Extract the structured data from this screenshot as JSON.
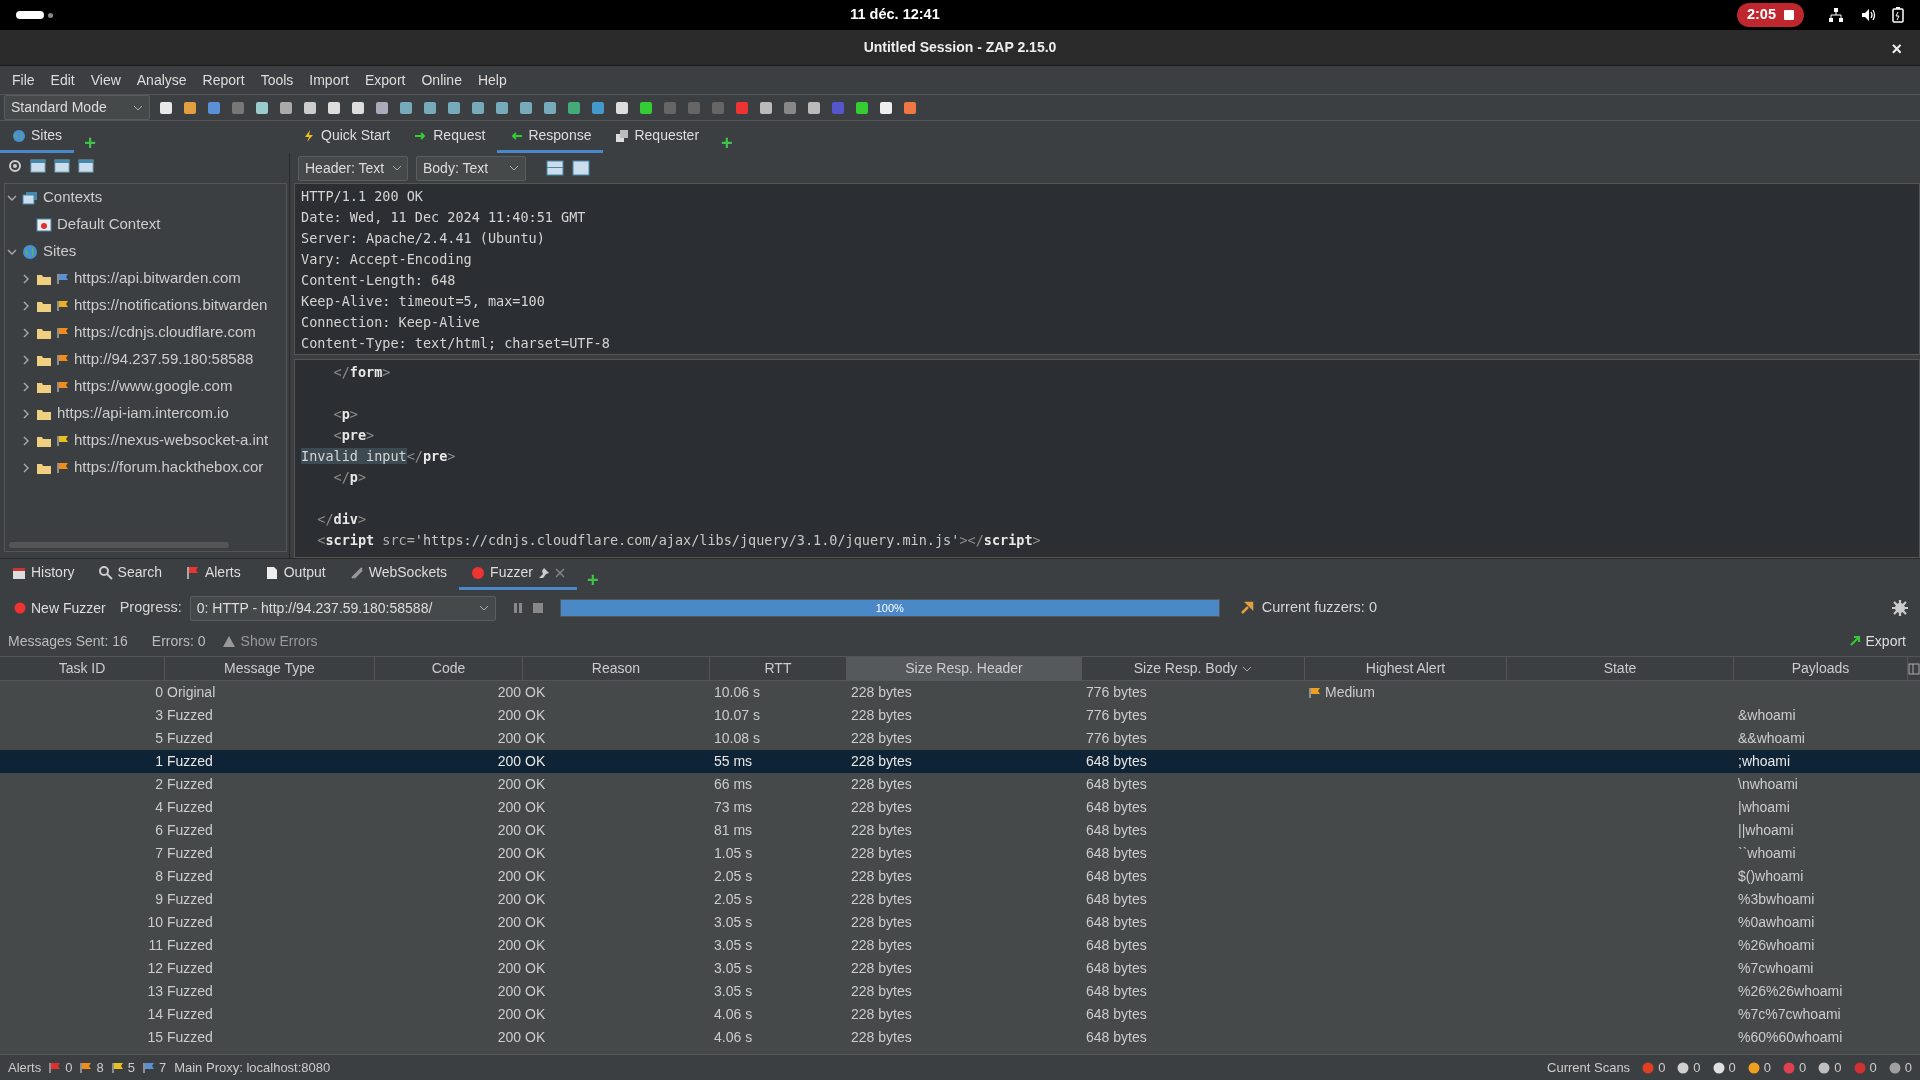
{
  "topbar": {
    "clock": "11 déc. 12:41",
    "recording": "2:05"
  },
  "window": {
    "title": "Untitled Session - ZAP 2.15.0",
    "close": "×"
  },
  "menu": [
    "File",
    "Edit",
    "View",
    "Analyse",
    "Report",
    "Tools",
    "Import",
    "Export",
    "Online",
    "Help"
  ],
  "toolbar": {
    "mode": "Standard Mode"
  },
  "left_tabs": [
    {
      "label": "Sites",
      "selected": true
    }
  ],
  "left_add_tab": "+",
  "sites_tree": [
    {
      "label": "Contexts",
      "expanded": true,
      "kind": "contexts",
      "children": [
        {
          "label": "Default Context",
          "kind": "context"
        }
      ]
    },
    {
      "label": "Sites",
      "expanded": true,
      "kind": "sites",
      "children": [
        {
          "label": "https://api.bitwarden.com",
          "expanded": false,
          "kind": "site",
          "color": "#5b8fd6"
        },
        {
          "label": "https://notifications.bitwarden",
          "expanded": false,
          "kind": "site",
          "color": "#e8b020"
        },
        {
          "label": "https://cdnjs.cloudflare.com",
          "expanded": false,
          "kind": "site",
          "color": "#f08c1c"
        },
        {
          "label": "http://94.237.59.180:58588",
          "expanded": false,
          "kind": "site",
          "color": "#f08c1c"
        },
        {
          "label": "https://www.google.com",
          "expanded": false,
          "kind": "site",
          "color": "#f08c1c"
        },
        {
          "label": "https://api-iam.intercom.io",
          "expanded": false,
          "kind": "site"
        },
        {
          "label": "https://nexus-websocket-a.int",
          "expanded": false,
          "kind": "site",
          "color": "#e8c020"
        },
        {
          "label": "https://forum.hackthebox.cor",
          "expanded": false,
          "kind": "site",
          "color": "#f08c1c"
        }
      ]
    }
  ],
  "work_tabs": [
    {
      "label": "Quick Start",
      "selected": false,
      "kind": "bolt"
    },
    {
      "label": "Request",
      "selected": false,
      "kind": "right"
    },
    {
      "label": "Response",
      "selected": true,
      "kind": "left"
    },
    {
      "label": "Requester",
      "selected": false,
      "kind": "pages"
    }
  ],
  "work_add_tab": "+",
  "view_selects": [
    "Header: Text",
    "Body: Text"
  ],
  "response_header": [
    "HTTP/1.1 200 OK",
    "Date: Wed, 11 Dec 2024 11:40:51 GMT",
    "Server: Apache/2.4.41 (Ubuntu)",
    "Vary: Accept-Encoding",
    "Content-Length: 648",
    "Keep-Alive: timeout=5, max=100",
    "Connection: Keep-Alive",
    "Content-Type: text/html; charset=UTF-8"
  ],
  "response_body": [
    {
      "kind": "code",
      "segments": [
        {
          "text": "    </",
          "kind": "punct"
        },
        {
          "text": "form",
          "kind": "tag"
        },
        {
          "text": ">",
          "kind": "punct"
        }
      ]
    },
    {
      "kind": "blank"
    },
    {
      "kind": "code",
      "segments": [
        {
          "text": "    <",
          "kind": "punct"
        },
        {
          "text": "p",
          "kind": "tag"
        },
        {
          "text": ">",
          "kind": "punct"
        }
      ]
    },
    {
      "kind": "code",
      "segments": [
        {
          "text": "    <",
          "kind": "punct"
        },
        {
          "text": "pre",
          "kind": "tag"
        },
        {
          "text": ">",
          "kind": "punct"
        }
      ]
    },
    {
      "kind": "code",
      "segments": [
        {
          "text": "Invalid input",
          "kind": "highlight"
        },
        {
          "text": "</",
          "kind": "punct"
        },
        {
          "text": "pre",
          "kind": "tag"
        },
        {
          "text": ">",
          "kind": "punct"
        }
      ]
    },
    {
      "kind": "code",
      "segments": [
        {
          "text": "    </",
          "kind": "punct"
        },
        {
          "text": "p",
          "kind": "tag"
        },
        {
          "text": ">",
          "kind": "punct"
        }
      ]
    },
    {
      "kind": "blank"
    },
    {
      "kind": "code",
      "segments": [
        {
          "text": "  </",
          "kind": "punct"
        },
        {
          "text": "div",
          "kind": "tag"
        },
        {
          "text": ">",
          "kind": "punct"
        }
      ]
    },
    {
      "kind": "code",
      "segments": [
        {
          "text": "  <",
          "kind": "punct"
        },
        {
          "text": "script",
          "kind": "tag"
        },
        {
          "text": " src=",
          "kind": "attr"
        },
        {
          "text": "'https://cdnjs.cloudflare.com/ajax/libs/jquery/3.1.0/jquery.min.js'",
          "kind": "string"
        },
        {
          "text": "></",
          "kind": "punct"
        },
        {
          "text": "script",
          "kind": "tag"
        },
        {
          "text": ">",
          "kind": "punct"
        }
      ]
    }
  ],
  "bottom_tabs": [
    {
      "label": "History",
      "selected": false,
      "kind": "history"
    },
    {
      "label": "Search",
      "selected": false,
      "kind": "search"
    },
    {
      "label": "Alerts",
      "selected": false,
      "kind": "alerts"
    },
    {
      "label": "Output",
      "selected": false,
      "kind": "output"
    },
    {
      "label": "WebSockets",
      "selected": false,
      "kind": "websockets"
    },
    {
      "label": "Fuzzer",
      "selected": true,
      "kind": "fuzzer"
    }
  ],
  "bottom_add_tab": "+",
  "fuzzer": {
    "new_button": "New Fuzzer",
    "progress_label": "Progress:",
    "progress_select": "0: HTTP - http://94.237.59.180:58588/",
    "level": 1,
    "progress_text": "100%",
    "current": "Current fuzzers: 0",
    "messages_sent": "Messages Sent: 16",
    "errors": "Errors: 0",
    "show_errors": "Show Errors",
    "export": "Export"
  },
  "table": {
    "columns": [
      {
        "label": "Task ID",
        "selected": false,
        "sorted": false
      },
      {
        "label": "Message Type",
        "selected": false,
        "sorted": false
      },
      {
        "label": "Code",
        "selected": false,
        "sorted": false
      },
      {
        "label": "Reason",
        "selected": false,
        "sorted": false
      },
      {
        "label": "RTT",
        "selected": false,
        "sorted": false
      },
      {
        "label": "Size Resp. Header",
        "selected": true,
        "sorted": false
      },
      {
        "label": "Size Resp. Body",
        "selected": false,
        "sorted": true
      },
      {
        "label": "Highest Alert",
        "selected": false,
        "sorted": false
      },
      {
        "label": "State",
        "selected": false,
        "sorted": false
      },
      {
        "label": "Payloads",
        "selected": false,
        "sorted": false
      }
    ],
    "rows": [
      {
        "cells": [
          "0",
          "Original",
          "200",
          "OK",
          "10.06 s",
          "228 bytes",
          "776 bytes",
          "Medium",
          "",
          ""
        ],
        "selected": false
      },
      {
        "cells": [
          "3",
          "Fuzzed",
          "200",
          "OK",
          "10.07 s",
          "228 bytes",
          "776 bytes",
          "",
          "",
          "&whoami"
        ],
        "selected": false
      },
      {
        "cells": [
          "5",
          "Fuzzed",
          "200",
          "OK",
          "10.08 s",
          "228 bytes",
          "776 bytes",
          "",
          "",
          "&&whoami"
        ],
        "selected": false
      },
      {
        "cells": [
          "1",
          "Fuzzed",
          "200",
          "OK",
          "55 ms",
          "228 bytes",
          "648 bytes",
          "",
          "",
          ";whoami"
        ],
        "selected": true
      },
      {
        "cells": [
          "2",
          "Fuzzed",
          "200",
          "OK",
          "66 ms",
          "228 bytes",
          "648 bytes",
          "",
          "",
          "\\nwhoami"
        ],
        "selected": false
      },
      {
        "cells": [
          "4",
          "Fuzzed",
          "200",
          "OK",
          "73 ms",
          "228 bytes",
          "648 bytes",
          "",
          "",
          "|whoami"
        ],
        "selected": false
      },
      {
        "cells": [
          "6",
          "Fuzzed",
          "200",
          "OK",
          "81 ms",
          "228 bytes",
          "648 bytes",
          "",
          "",
          "||whoami"
        ],
        "selected": false
      },
      {
        "cells": [
          "7",
          "Fuzzed",
          "200",
          "OK",
          "1.05 s",
          "228 bytes",
          "648 bytes",
          "",
          "",
          "``whoami"
        ],
        "selected": false
      },
      {
        "cells": [
          "8",
          "Fuzzed",
          "200",
          "OK",
          "2.05 s",
          "228 bytes",
          "648 bytes",
          "",
          "",
          "$()whoami"
        ],
        "selected": false
      },
      {
        "cells": [
          "9",
          "Fuzzed",
          "200",
          "OK",
          "2.05 s",
          "228 bytes",
          "648 bytes",
          "",
          "",
          "%3bwhoami"
        ],
        "selected": false
      },
      {
        "cells": [
          "10",
          "Fuzzed",
          "200",
          "OK",
          "3.05 s",
          "228 bytes",
          "648 bytes",
          "",
          "",
          "%0awhoami"
        ],
        "selected": false
      },
      {
        "cells": [
          "11",
          "Fuzzed",
          "200",
          "OK",
          "3.05 s",
          "228 bytes",
          "648 bytes",
          "",
          "",
          "%26whoami"
        ],
        "selected": false
      },
      {
        "cells": [
          "12",
          "Fuzzed",
          "200",
          "OK",
          "3.05 s",
          "228 bytes",
          "648 bytes",
          "",
          "",
          "%7cwhoami"
        ],
        "selected": false
      },
      {
        "cells": [
          "13",
          "Fuzzed",
          "200",
          "OK",
          "3.05 s",
          "228 bytes",
          "648 bytes",
          "",
          "",
          "%26%26whoami"
        ],
        "selected": false
      },
      {
        "cells": [
          "14",
          "Fuzzed",
          "200",
          "OK",
          "4.06 s",
          "228 bytes",
          "648 bytes",
          "",
          "",
          "%7c%7cwhoami"
        ],
        "selected": false
      },
      {
        "cells": [
          "15",
          "Fuzzed",
          "200",
          "OK",
          "4.06 s",
          "228 bytes",
          "648 bytes",
          "",
          "",
          "%60%60whoami"
        ],
        "selected": false
      }
    ]
  },
  "status_bar": {
    "alerts_label": "Alerts",
    "alert_counts": [
      {
        "count": "0",
        "color": "#e03030"
      },
      {
        "count": "8",
        "color": "#f08c1c"
      },
      {
        "count": "5",
        "color": "#e8c020"
      },
      {
        "count": "7",
        "color": "#5b8fd6"
      }
    ],
    "proxy": "Main Proxy: localhost:8080",
    "scans_label": "Current Scans",
    "scan_counts": [
      {
        "count": "0",
        "color": "#e04020"
      },
      {
        "count": "0",
        "color": "#d0d0d0"
      },
      {
        "count": "0",
        "color": "#e0e0e0"
      },
      {
        "count": "0",
        "color": "#f0a020"
      },
      {
        "count": "0",
        "color": "#e04050"
      },
      {
        "count": "0",
        "color": "#c0c0c0"
      },
      {
        "count": "0",
        "color": "#d03030"
      },
      {
        "count": "0",
        "color": "#a0a0a0"
      }
    ]
  }
}
